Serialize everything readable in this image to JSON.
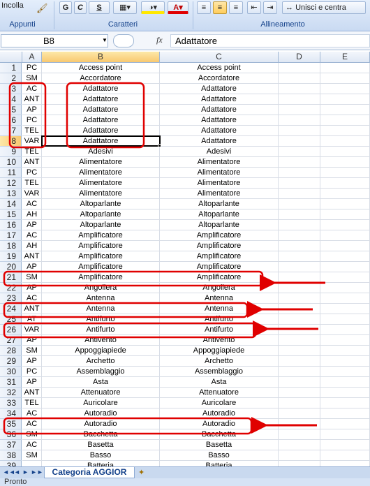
{
  "ribbon": {
    "paste_label": "Incolla",
    "clipboard_label": "Appunti",
    "bold": "G",
    "italic": "C",
    "underline": "S",
    "font_group_label": "Caratteri",
    "merge_label": "Unisci e centra",
    "align_group_label": "Allineamento"
  },
  "formula_bar": {
    "name_box": "B8",
    "fx": "fx",
    "value": "Adattatore"
  },
  "columns": [
    "A",
    "B",
    "C",
    "D",
    "E"
  ],
  "rows": [
    [
      "PC",
      "Access point",
      "Access point"
    ],
    [
      "SM",
      "Accordatore",
      "Accordatore"
    ],
    [
      "AC",
      "Adattatore",
      "Adattatore"
    ],
    [
      "ANT",
      "Adattatore",
      "Adattatore"
    ],
    [
      "AP",
      "Adattatore",
      "Adattatore"
    ],
    [
      "PC",
      "Adattatore",
      "Adattatore"
    ],
    [
      "TEL",
      "Adattatore",
      "Adattatore"
    ],
    [
      "VAR",
      "Adattatore",
      "Adattatore"
    ],
    [
      "TEL",
      "Adesivi",
      "Adesivi"
    ],
    [
      "ANT",
      "Alimentatore",
      "Alimentatore"
    ],
    [
      "PC",
      "Alimentatore",
      "Alimentatore"
    ],
    [
      "TEL",
      "Alimentatore",
      "Alimentatore"
    ],
    [
      "VAR",
      "Alimentatore",
      "Alimentatore"
    ],
    [
      "AC",
      "Altoparlante",
      "Altoparlante"
    ],
    [
      "AH",
      "Altoparlante",
      "Altoparlante"
    ],
    [
      "AP",
      "Altoparlante",
      "Altoparlante"
    ],
    [
      "AC",
      "Amplificatore",
      "Amplificatore"
    ],
    [
      "AH",
      "Amplificatore",
      "Amplificatore"
    ],
    [
      "ANT",
      "Amplificatore",
      "Amplificatore"
    ],
    [
      "AP",
      "Amplificatore",
      "Amplificatore"
    ],
    [
      "SM",
      "Amplificatore",
      "Amplificatore"
    ],
    [
      "AP",
      "Angoliera",
      "Angoliera"
    ],
    [
      "AC",
      "Antenna",
      "Antenna"
    ],
    [
      "ANT",
      "Antenna",
      "Antenna"
    ],
    [
      "AT",
      "Antifurto",
      "Antifurto"
    ],
    [
      "VAR",
      "Antifurto",
      "Antifurto"
    ],
    [
      "AP",
      "Antivento",
      "Antivento"
    ],
    [
      "SM",
      "Appoggiapiede",
      "Appoggiapiede"
    ],
    [
      "AP",
      "Archetto",
      "Archetto"
    ],
    [
      "PC",
      "Assemblaggio",
      "Assemblaggio"
    ],
    [
      "AP",
      "Asta",
      "Asta"
    ],
    [
      "ANT",
      "Attenuatore",
      "Attenuatore"
    ],
    [
      "TEL",
      "Auricolare",
      "Auricolare"
    ],
    [
      "AC",
      "Autoradio",
      "Autoradio"
    ],
    [
      "AC",
      "Autoradio",
      "Autoradio"
    ],
    [
      "SM",
      "Bacchetta",
      "Bacchetta"
    ],
    [
      "AC",
      "Basetta",
      "Basetta"
    ],
    [
      "SM",
      "Basso",
      "Basso"
    ],
    [
      "",
      "Batteria",
      "Batteria"
    ]
  ],
  "sheet_tab": "Categoria AGGIOR",
  "status": "Pronto",
  "colors": {
    "annotation": "#e00000",
    "ribbon": "#c9daf2",
    "selected_header": "#f8c870"
  }
}
